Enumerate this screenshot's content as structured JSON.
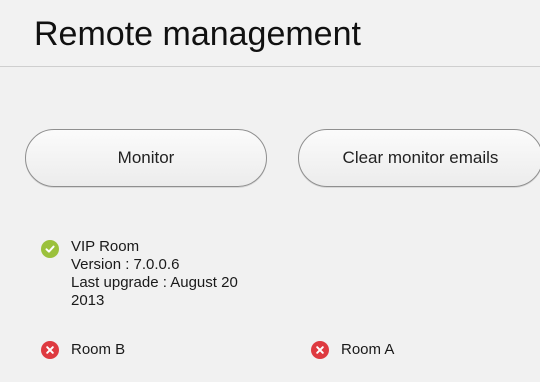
{
  "header": {
    "title": "Remote management"
  },
  "actions": {
    "monitor_label": "Monitor",
    "clear_label": "Clear monitor emails"
  },
  "rooms": {
    "vip": {
      "name": "VIP Room",
      "version": "Version : 7.0.0.6",
      "last_upgrade_line1": "Last upgrade : August 20",
      "last_upgrade_line2": "2013",
      "status": "ok",
      "status_icon": "check-circle-icon"
    },
    "room_b": {
      "name": "Room B",
      "status": "error",
      "status_icon": "x-circle-icon"
    },
    "room_a": {
      "name": "Room A",
      "status": "error",
      "status_icon": "x-circle-icon"
    }
  },
  "colors": {
    "ok": "#9bc13c",
    "error": "#de3a40",
    "background": "#f1f1f1"
  }
}
